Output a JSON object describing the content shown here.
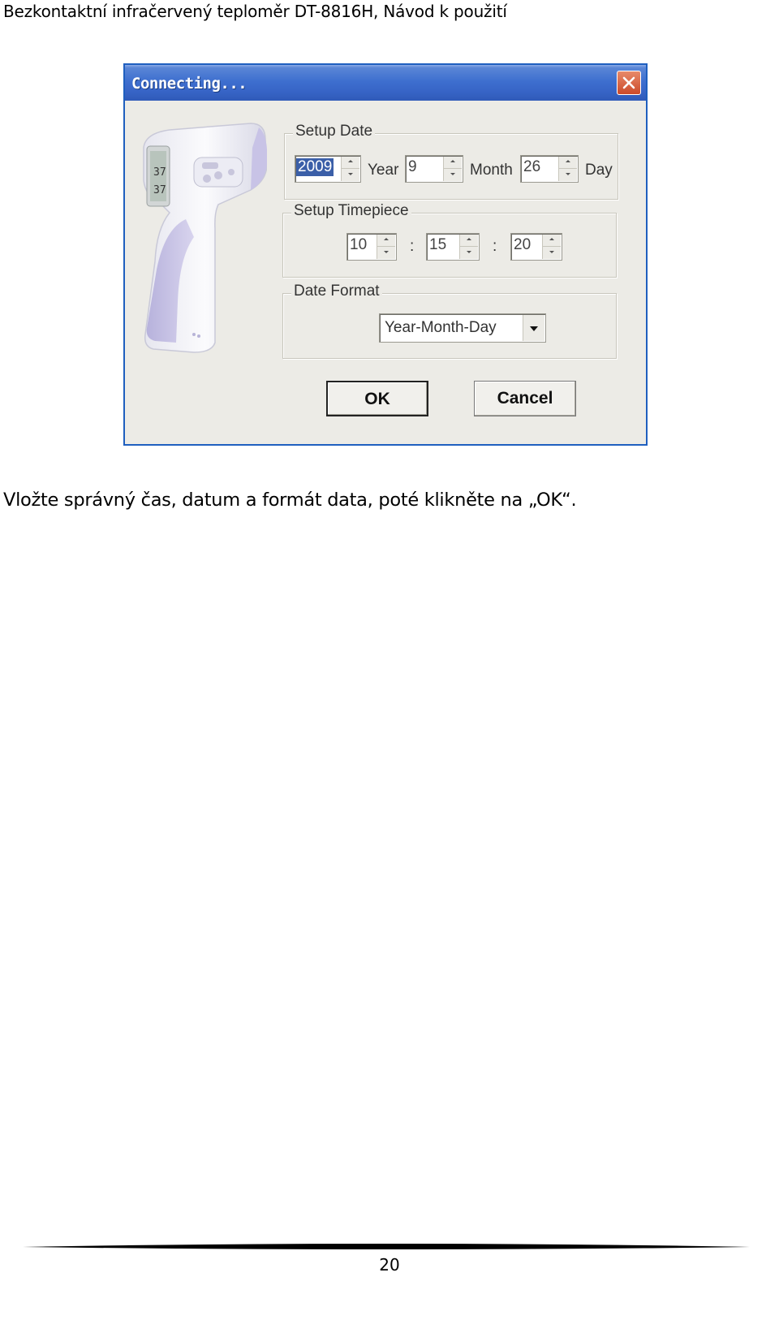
{
  "header": {
    "text": "Bezkontaktní infračervený teploměr DT-8816H, Návod k použití"
  },
  "dialog": {
    "title": "Connecting...",
    "setup_date": {
      "legend": "Setup Date",
      "year_value": "2009",
      "year_label": "Year",
      "month_value": "9",
      "month_label": "Month",
      "day_value": "26",
      "day_label": "Day"
    },
    "setup_time": {
      "legend": "Setup Timepiece",
      "hour": "10",
      "minute": "15",
      "second": "20",
      "separator": ":"
    },
    "date_format": {
      "legend": "Date Format",
      "selected": "Year-Month-Day"
    },
    "ok_label": "OK",
    "cancel_label": "Cancel"
  },
  "instruction": "Vložte správný čas, datum a formát data, poté klikněte na „OK“.",
  "footer": {
    "page_number": "20"
  },
  "icons": {
    "close": "close-icon",
    "thermometer": "thermometer-image"
  },
  "colors": {
    "titlebar": "#3764c6",
    "close": "#cc4a2a",
    "dialog_bg": "#ecebe6",
    "selection": "#3b5fa8"
  }
}
